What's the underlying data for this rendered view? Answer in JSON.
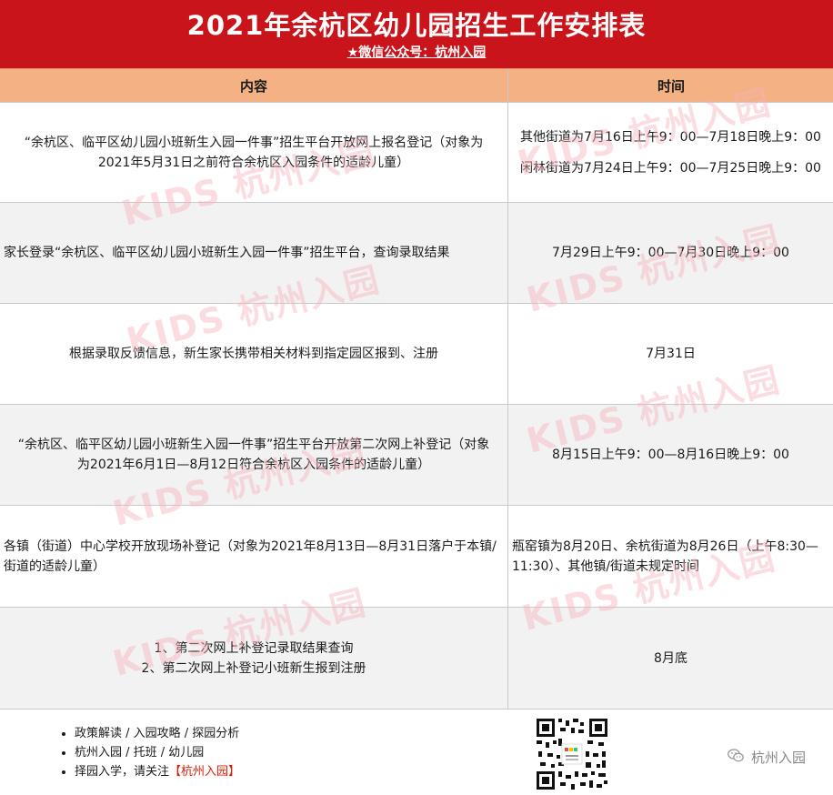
{
  "header": {
    "title": "2021年余杭区幼儿园招生工作安排表",
    "subtitle": "★微信公众号：杭州入园"
  },
  "table": {
    "col_content": "内容",
    "col_time": "时间",
    "rows": [
      {
        "content": "“余杭区、临平区幼儿园小班新生入园一件事”招生平台开放网上报名登记（对象为2021年5月31日之前符合余杭区入园条件的适龄儿童）",
        "time": [
          "其他街道为7月16日上午9：00—7月18日晚上9：00",
          "闲林街道为7月24日上午9：00—7月25日晚上9：00"
        ]
      },
      {
        "content": "家长登录“余杭区、临平区幼儿园小班新生入园一件事”招生平台，查询录取结果",
        "time": [
          "7月29日上午9：00—7月30日晚上9：00"
        ]
      },
      {
        "content": "根据录取反馈信息，新生家长携带相关材料到指定园区报到、注册",
        "time": [
          "7月31日"
        ]
      },
      {
        "content": "“余杭区、临平区幼儿园小班新生入园一件事”招生平台开放第二次网上补登记（对象为2021年6月1日—8月12日符合余杭区入园条件的适龄儿童）",
        "time": [
          "8月15日上午9：00—8月16日晚上9：00"
        ]
      },
      {
        "content": "各镇（街道）中心学校开放现场补登记（对象为2021年8月13日—8月31日落户于本镇/街道的适龄儿童）",
        "time": [
          "瓶窑镇为8月20日、余杭街道为8月26日（上午8:30—11:30）、其他镇/街道未规定时间"
        ]
      },
      {
        "content": [
          "1、第二次网上补登记录取结果查询",
          "2、第二次网上补登记小班新生报到注册"
        ],
        "time": [
          "8月底"
        ]
      }
    ]
  },
  "watermark": "KIDS 杭州入园",
  "footer": {
    "bullets": [
      "政策解读 / 入园攻略 / 探园分析",
      "杭州入园 / 托班 / 幼儿园",
      "择园入学，请关注"
    ],
    "highlight": "【杭州入园】",
    "brand": "杭州入园",
    "qr_icon": "qr-code-icon",
    "wechat_icon": "wechat-icon"
  },
  "colors": {
    "header_bg": "#c9141b",
    "thead_bg": "#f4b183",
    "row_alt_bg": "#f2f2f2",
    "highlight": "#d81e06"
  }
}
